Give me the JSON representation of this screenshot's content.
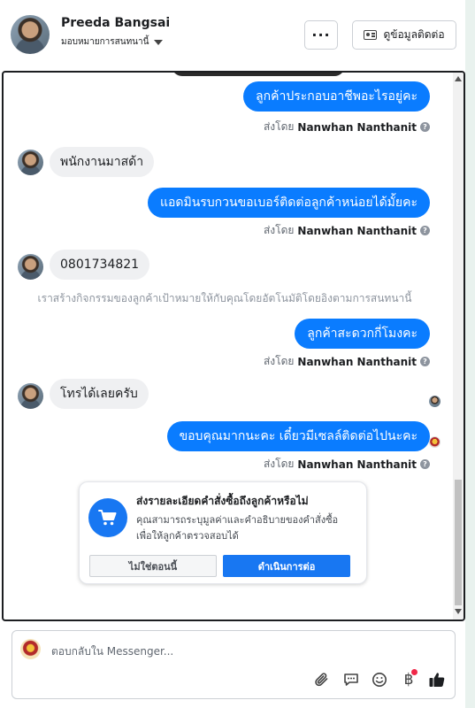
{
  "header": {
    "name": "Preeda Bangsai",
    "assign_label": "มอบหมายการสนทนานี้",
    "more_label": "···",
    "contact_label": "ดูข้อมูลติดต่อ"
  },
  "messages": [
    {
      "direction": "out",
      "text": "ลูกค้าประกอบอาชีพอะไรอยู่คะ"
    },
    {
      "direction": "in",
      "text": "พนักงานมาสด้า"
    },
    {
      "direction": "out",
      "text": "แอดมินรบกวนขอเบอร์ติดต่อลูกค้าหน่อยได้มั้ยคะ"
    },
    {
      "direction": "in",
      "text": "0801734821"
    },
    {
      "direction": "out",
      "text": "ลูกค้าสะดวกกี่โมงคะ"
    },
    {
      "direction": "in",
      "text": "โทรได้เลยครับ"
    },
    {
      "direction": "out",
      "text": "ขอบคุณมากนะคะ เดี๋ยวมีเซลล์ติดต่อไปนะคะ"
    }
  ],
  "sent_by": {
    "prefix": "ส่งโดย",
    "agent": "Nanwhan Nanthanit",
    "help": "?"
  },
  "system_note": "เราสร้างกิจกรรมของลูกค้าเป้าหมายให้กับคุณโดยอัตโนมัติโดยอิงตามการสนทนานี้",
  "order_card": {
    "title": "ส่งรายละเอียดคำสั่งซื้อถึงลูกค้าหรือไม่",
    "desc_line1": "คุณสามารถระบุมูลค่าและคำอธิบายของคำสั่งซื้อ",
    "desc_line2": "เพื่อให้ลูกค้าตรวจสอบได้",
    "decline_label": "ไม่ใช่ตอนนี้",
    "accept_label": "ดำเนินการต่อ",
    "icon": "shopping-cart-icon"
  },
  "composer": {
    "placeholder": "ตอบกลับใน Messenger...",
    "currency_symbol": "฿"
  },
  "colors": {
    "outgoing_bubble": "#0a7cff",
    "incoming_bubble": "#eff0f2",
    "primary_button": "#1877f2",
    "like_icon": "#1c1e21"
  }
}
